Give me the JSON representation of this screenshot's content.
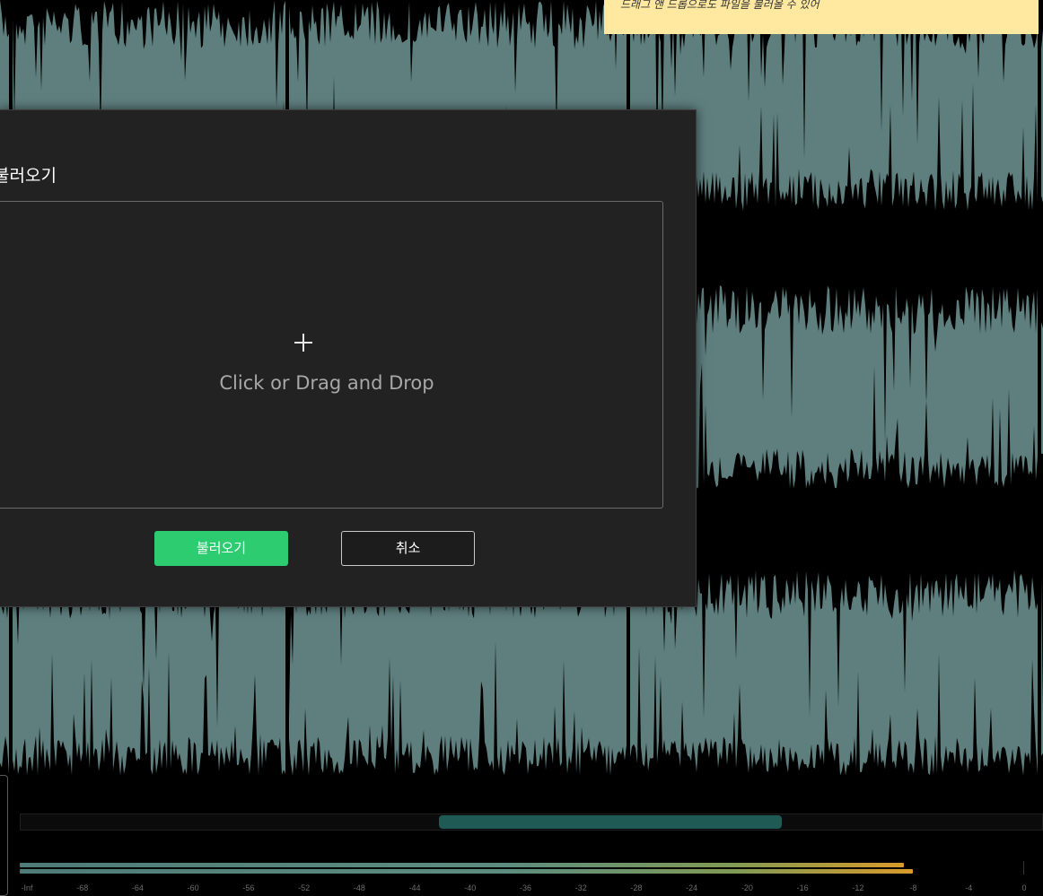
{
  "tooltip": {
    "text": "드래그 앤 드롭으로도 파일을 불러올 수 있어"
  },
  "dialog": {
    "title": "불러오기",
    "dropzone_text": "Click or Drag and Drop",
    "confirm_label": "불러오기",
    "cancel_label": "취소"
  },
  "meter": {
    "ticks": [
      "-Inf",
      "-68",
      "-64",
      "-60",
      "-56",
      "-52",
      "-48",
      "-44",
      "-40",
      "-36",
      "-32",
      "-28",
      "-24",
      "-20",
      "-16",
      "-12",
      "-8",
      "-4",
      "0"
    ],
    "level_left_db": -7,
    "level_right_db": -6.3
  },
  "colors": {
    "accent": "#2ecc71",
    "waveform": "#5f7f7f",
    "scroll_thumb": "#1f5a55",
    "tooltip_bg": "#ffe9a0",
    "meter_hot": "#d99a2a"
  },
  "icons": {
    "dropzone": "plus-icon"
  }
}
